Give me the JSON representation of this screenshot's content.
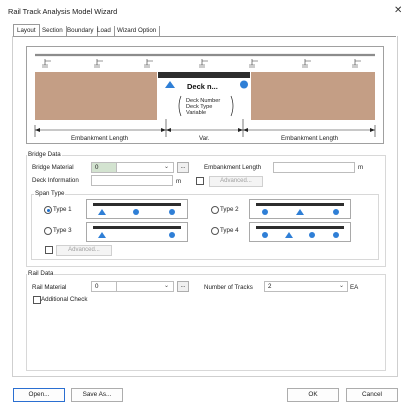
{
  "window": {
    "title": "Rail Track Analysis Model Wizard",
    "close_glyph": "✕"
  },
  "tabs": [
    "Layout",
    "Section",
    "Boundary",
    "Load",
    "Wizard Option"
  ],
  "diagram": {
    "deck_label": "Deck n...",
    "deck_info_lines": [
      "Deck Number",
      "Deck Type",
      "Variable"
    ],
    "dim_left": "Embankment Length",
    "dim_mid": "Var.",
    "dim_right": "Embankment Length"
  },
  "bridge_data": {
    "legend": "Bridge Data",
    "bridge_material_label": "Bridge Material",
    "bridge_material_value": "0",
    "embankment_length_label": "Embankment Length",
    "embankment_length_value": "",
    "embankment_unit": "m",
    "deck_information_label": "Deck Information",
    "deck_information_value": "",
    "deck_unit": "m",
    "advanced_label": "Advanced...",
    "ellipsis": "..."
  },
  "span_type": {
    "legend": "Span Type",
    "types": [
      {
        "label": "Type 1",
        "selected": true
      },
      {
        "label": "Type 2",
        "selected": false
      },
      {
        "label": "Type 3",
        "selected": false
      },
      {
        "label": "Type 4",
        "selected": false
      }
    ],
    "advanced_label": "Advanced..."
  },
  "rail_data": {
    "legend": "Rail Data",
    "rail_material_label": "Rail Material",
    "rail_material_value": "0",
    "number_of_tracks_label": "Number of Tracks",
    "number_of_tracks_value": "2",
    "tracks_unit": "EA",
    "additional_check_label": "Additional Check",
    "ellipsis": "..."
  },
  "buttons": {
    "open": "Open...",
    "save_as": "Save As...",
    "ok": "OK",
    "cancel": "Cancel"
  },
  "colors": {
    "embankment": "#c49e85",
    "deck": "#2d2d2d",
    "support": "#2f7fd6",
    "rail": "#8c8c8c",
    "active_border": "#2b6fd1"
  }
}
